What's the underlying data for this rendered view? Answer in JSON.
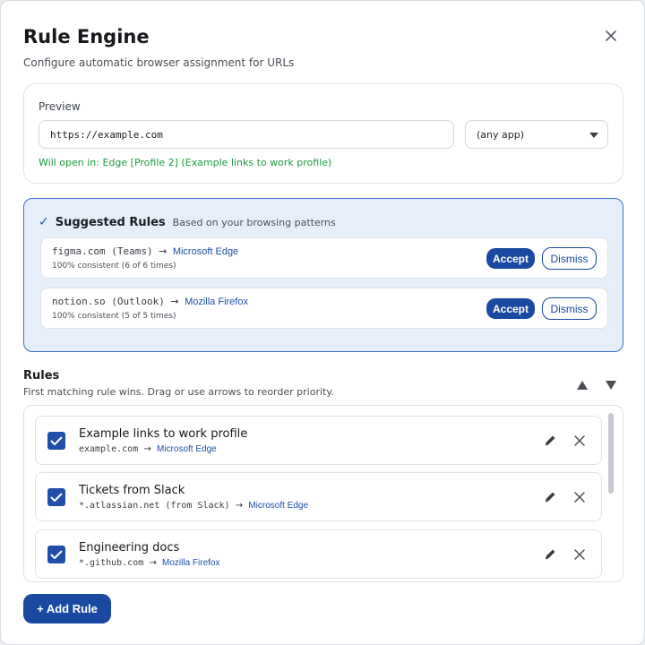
{
  "dialog": {
    "title": "Rule Engine",
    "subtitle": "Configure automatic browser assignment for URLs",
    "close_icon": "close-icon"
  },
  "preview": {
    "label": "Preview",
    "url_value": "https://example.com",
    "app_select_value": "(any app)",
    "result": "Will open in: Edge [Profile 2] (Example links to work profile)"
  },
  "suggested": {
    "title": "Suggested Rules",
    "description": "Based on your browsing patterns",
    "accept_label": "Accept",
    "dismiss_label": "Dismiss",
    "items": [
      {
        "pattern": "figma.com (Teams)",
        "arrow": "→",
        "browser": "Microsoft Edge",
        "consistency": "100% consistent (6 of 6 times)"
      },
      {
        "pattern": "notion.so (Outlook)",
        "arrow": "→",
        "browser": "Mozilla Firefox",
        "consistency": "100% consistent (5 of 5 times)"
      }
    ]
  },
  "rules": {
    "title": "Rules",
    "description": "First matching rule wins. Drag or use arrows to reorder priority.",
    "items": [
      {
        "name": "Example links to work profile",
        "pattern": "example.com",
        "arrow": "→",
        "browser": "Microsoft Edge",
        "enabled": true
      },
      {
        "name": "Tickets from Slack",
        "pattern": "*.atlassian.net (from Slack)",
        "arrow": "→",
        "browser": "Microsoft Edge",
        "enabled": true
      },
      {
        "name": "Engineering docs",
        "pattern": "*.github.com",
        "arrow": "→",
        "browser": "Mozilla Firefox",
        "enabled": true
      }
    ]
  },
  "footer": {
    "add_rule_label": "+ Add Rule"
  },
  "colors": {
    "accent": "#1949a0",
    "success": "#1e9a3f",
    "suggest_bg": "#e6eef9",
    "suggest_border": "#3d6fd0"
  }
}
